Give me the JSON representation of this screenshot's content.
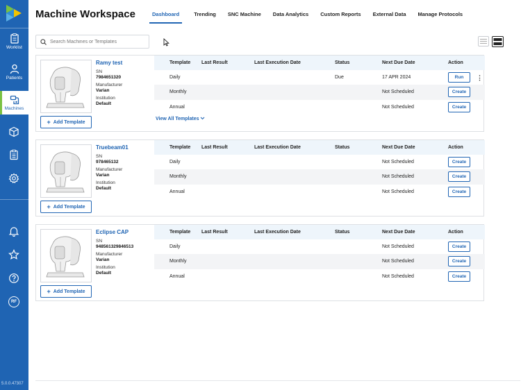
{
  "app": {
    "title": "Machine Workspace",
    "version": "5.0.0.47307"
  },
  "sidebar": {
    "items": [
      {
        "label": "Worklist",
        "icon": "clipboard-icon"
      },
      {
        "label": "Patients",
        "icon": "person-icon"
      },
      {
        "label": "Machines",
        "icon": "machine-icon",
        "active": true
      }
    ],
    "tools": [
      "cube-icon",
      "checklist-icon",
      "gear-icon"
    ],
    "bottom": [
      "bell-icon",
      "star-icon",
      "help-icon",
      "user-avatar-icon"
    ],
    "avatar_initials": "RF"
  },
  "tabs": [
    {
      "label": "Dashboard",
      "active": true
    },
    {
      "label": "Trending"
    },
    {
      "label": "SNC Machine"
    },
    {
      "label": "Data Analytics"
    },
    {
      "label": "Custom Reports"
    },
    {
      "label": "External Data"
    },
    {
      "label": "Manage Protocols"
    }
  ],
  "search": {
    "placeholder": "Search Machines or Templates"
  },
  "table_headers": [
    "Template",
    "Last Result",
    "Last Execution Date",
    "Status",
    "Next Due Date",
    "Action"
  ],
  "labels": {
    "sn": "SN",
    "manufacturer": "Manufacturer",
    "institution": "Institution",
    "add_template": "Add Template",
    "view_all": "View All Templates"
  },
  "machines": [
    {
      "name": "Ramy test",
      "sn": "7984651320",
      "manufacturer": "Varian",
      "institution": "Default",
      "rows": [
        {
          "template": "Daily",
          "last_result": "",
          "last_exec": "",
          "status": "Due",
          "next_due": "17 APR 2024",
          "action": "Run",
          "menu": true
        },
        {
          "template": "Monthly",
          "last_result": "",
          "last_exec": "",
          "status": "",
          "next_due": "Not Scheduled",
          "action": "Create"
        },
        {
          "template": "Annual",
          "last_result": "",
          "last_exec": "",
          "status": "",
          "next_due": "Not Scheduled",
          "action": "Create"
        }
      ],
      "view_all": true
    },
    {
      "name": "Truebeam01",
      "sn": "978465132",
      "manufacturer": "Varian",
      "institution": "Default",
      "rows": [
        {
          "template": "Daily",
          "last_result": "",
          "last_exec": "",
          "status": "",
          "next_due": "Not Scheduled",
          "action": "Create"
        },
        {
          "template": "Monthly",
          "last_result": "",
          "last_exec": "",
          "status": "",
          "next_due": "Not Scheduled",
          "action": "Create"
        },
        {
          "template": "Annual",
          "last_result": "",
          "last_exec": "",
          "status": "",
          "next_due": "Not Scheduled",
          "action": "Create"
        }
      ]
    },
    {
      "name": "Eclipse CAP",
      "sn": "948561329846513",
      "manufacturer": "Varian",
      "institution": "Default",
      "rows": [
        {
          "template": "Daily",
          "last_result": "",
          "last_exec": "",
          "status": "",
          "next_due": "Not Scheduled",
          "action": "Create"
        },
        {
          "template": "Monthly",
          "last_result": "",
          "last_exec": "",
          "status": "",
          "next_due": "Not Scheduled",
          "action": "Create"
        },
        {
          "template": "Annual",
          "last_result": "",
          "last_exec": "",
          "status": "",
          "next_due": "Not Scheduled",
          "action": "Create"
        }
      ]
    }
  ],
  "colors": {
    "brand": "#1f64b3",
    "accent": "#7ac143",
    "header_bg": "#eef5fb"
  }
}
